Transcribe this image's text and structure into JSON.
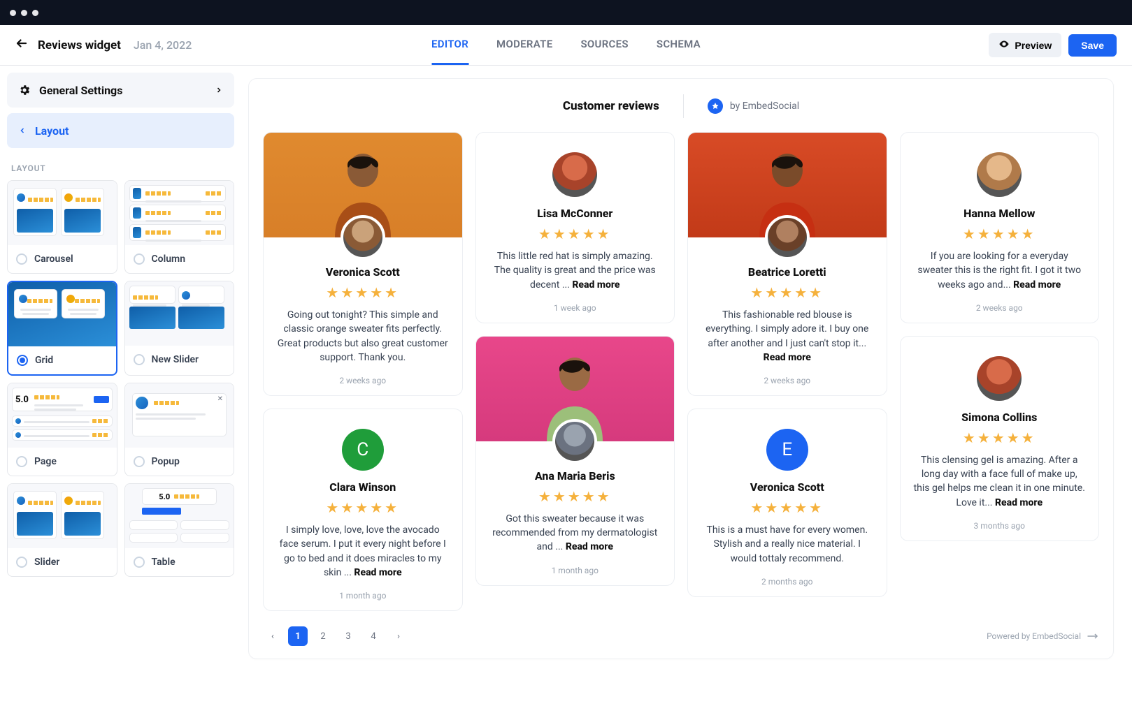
{
  "header": {
    "title": "Reviews widget",
    "date": "Jan 4, 2022",
    "tabs": [
      "EDITOR",
      "MODERATE",
      "SOURCES",
      "SCHEMA"
    ],
    "active_tab": 0,
    "preview_label": "Preview",
    "save_label": "Save"
  },
  "sidebar": {
    "general_label": "General Settings",
    "layout_label": "Layout",
    "section_label": "LAYOUT",
    "options": [
      {
        "label": "Carousel"
      },
      {
        "label": "Column"
      },
      {
        "label": "Grid",
        "selected": true
      },
      {
        "label": "New Slider"
      },
      {
        "label": "Page"
      },
      {
        "label": "Popup"
      },
      {
        "label": "Slider"
      },
      {
        "label": "Table"
      }
    ]
  },
  "canvas": {
    "title": "Customer reviews",
    "brand": "by EmbedSocial",
    "read_more": "Read more",
    "powered": "Powered by EmbedSocial",
    "pages": [
      "1",
      "2",
      "3",
      "4"
    ],
    "active_page": 0,
    "reviews": [
      {
        "name": "Veronica Scott",
        "stars": 5,
        "hero": "orange",
        "text": "Going out tonight? This simple and classic orange sweater fits perfectly. Great products but also great customer support. Thank you.",
        "time": "2 weeks ago"
      },
      {
        "name": "Lisa McConner",
        "stars": 5,
        "text": "This little red hat is simply amazing. The quality is great and the price was decent ... ",
        "more": true,
        "time": "1 week ago"
      },
      {
        "name": "Beatrice Loretti",
        "stars": 5,
        "hero": "red",
        "text": "This fashionable red blouse is everything. I simply adore it. I buy one after another and I just can't stop it... ",
        "more": true,
        "time": "2 weeks ago"
      },
      {
        "name": "Hanna Mellow",
        "stars": 5,
        "text": "If you are looking for a everyday sweater this is the right fit. I got it two weeks ago and... ",
        "more": true,
        "time": "2 weeks ago"
      },
      {
        "name": "Clara Winson",
        "stars": 5,
        "letter": "C",
        "letter_color": "#1f9d3a",
        "text": "I simply love, love, love the avocado face serum. I put it every night before I go to bed and it does miracles to my skin ... ",
        "more": true,
        "time": "1 month ago"
      },
      {
        "name": "Ana Maria Beris",
        "stars": 5,
        "hero": "pink",
        "text": "Got this sweater because it was recommended from my dermatologist and ... ",
        "more": true,
        "time": "1 month ago"
      },
      {
        "name": "Veronica Scott",
        "stars": 5,
        "letter": "E",
        "letter_color": "#1c64f2",
        "text": "This is a must have for every women. Stylish and a really nice material. I would tottaly recommend.",
        "time": "2 months ago"
      },
      {
        "name": "Simona Collins",
        "stars": 5,
        "text": "This clensing gel is amazing. After a long day with a face full of make up, this gel helps me clean it in one minute. Love it... ",
        "more": true,
        "time": "3 months ago"
      }
    ]
  }
}
